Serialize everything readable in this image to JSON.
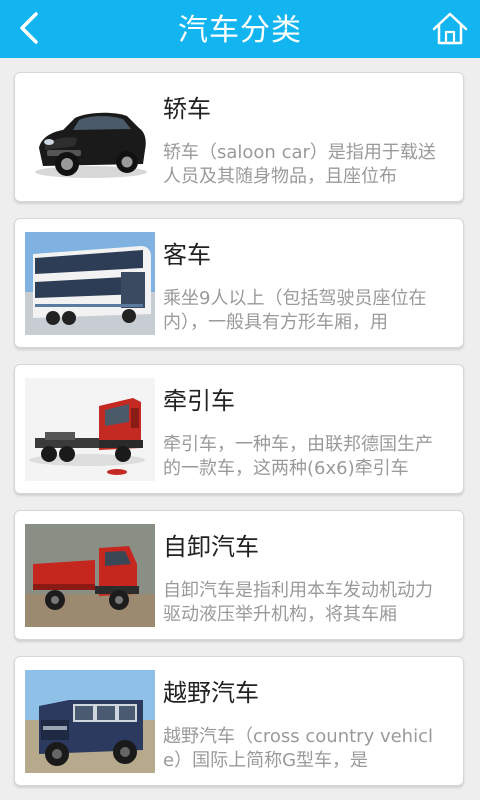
{
  "header": {
    "title": "汽车分类",
    "background": "#12b5ef",
    "back_icon": "chevron-left-icon",
    "home_icon": "home-icon"
  },
  "categories": [
    {
      "name": "轿车",
      "description": "轿车（saloon car）是指用于载送人员及其随身物品，且座位布",
      "image": "sedan-photo"
    },
    {
      "name": "客车",
      "description": "乘坐9人以上（包括驾驶员座位在内），一般具有方形车厢，用",
      "image": "double-decker-bus-photo"
    },
    {
      "name": "牵引车",
      "description": "牵引车，一种车，由联邦德国生产的一款车，这两种(6x6)牵引车",
      "image": "red-tractor-truck-photo"
    },
    {
      "name": "自卸汽车",
      "description": "自卸汽车是指利用本车发动机动力驱动液压举升机构，将其车厢",
      "image": "red-dump-truck-photo"
    },
    {
      "name": "越野汽车",
      "description": "越野汽车（cross country vehicle）国际上简称G型车，是",
      "image": "offroad-suv-photo"
    }
  ]
}
